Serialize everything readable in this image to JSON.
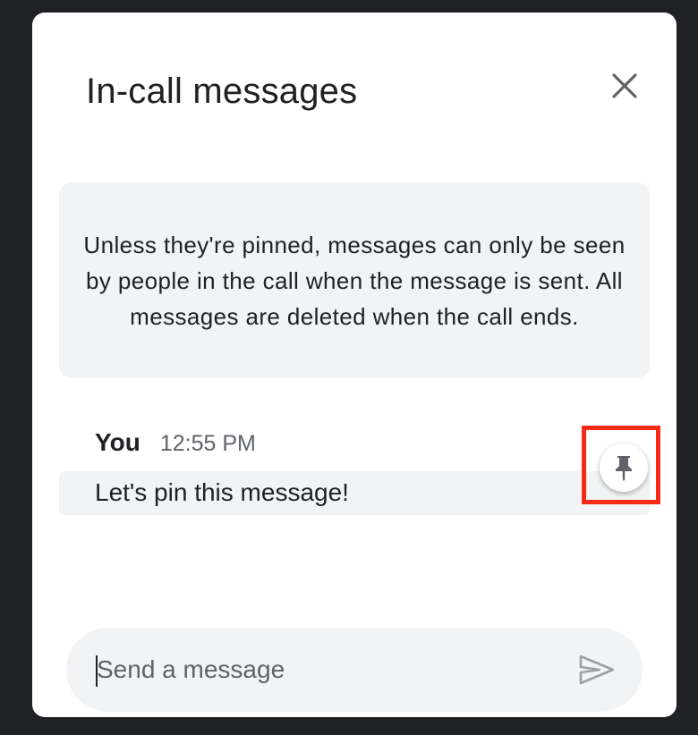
{
  "panel": {
    "title": "In-call messages",
    "close_icon": "close-icon",
    "notice": "Unless they're pinned, messages can only be seen by people in the call when the message is sent. All messages are deleted when the call ends."
  },
  "messages": [
    {
      "sender": "You",
      "time": "12:55 PM",
      "text": "Let's pin this message!",
      "pin_icon": "pin-icon"
    }
  ],
  "composer": {
    "placeholder": "Send a message",
    "value": "",
    "send_icon": "send-icon"
  },
  "colors": {
    "backdrop": "#202124",
    "surface": "#f1f3f4",
    "highlight": "#f42b16",
    "icon": "#5f6368"
  }
}
